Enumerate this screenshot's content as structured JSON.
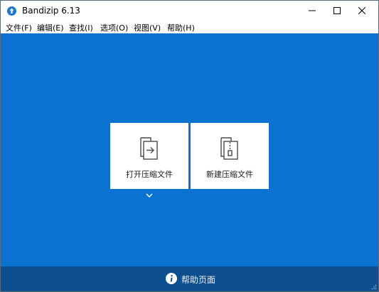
{
  "window": {
    "title": "Bandizip 6.13",
    "app_icon": "bandizip-logo-icon",
    "controls": [
      "minimize-icon",
      "maximize-icon",
      "close-icon"
    ]
  },
  "menu": {
    "items": [
      {
        "label": "文件(F)"
      },
      {
        "label": "编辑(E)"
      },
      {
        "label": "查找(I)"
      },
      {
        "label": "选项(O)"
      },
      {
        "label": "视图(V)"
      },
      {
        "label": "帮助(H)"
      }
    ]
  },
  "main": {
    "open_archive": {
      "label": "打开压缩文件",
      "icon": "open-archive-icon"
    },
    "new_archive": {
      "label": "新建压缩文件",
      "icon": "new-archive-icon"
    },
    "more_icon": "chevron-down-icon"
  },
  "footer": {
    "help_label": "帮助页面",
    "help_icon": "info-icon"
  },
  "colors": {
    "main_bg": "#0a72d1",
    "footer_bg": "#0d4e8f",
    "tile_bg": "#ffffff"
  }
}
